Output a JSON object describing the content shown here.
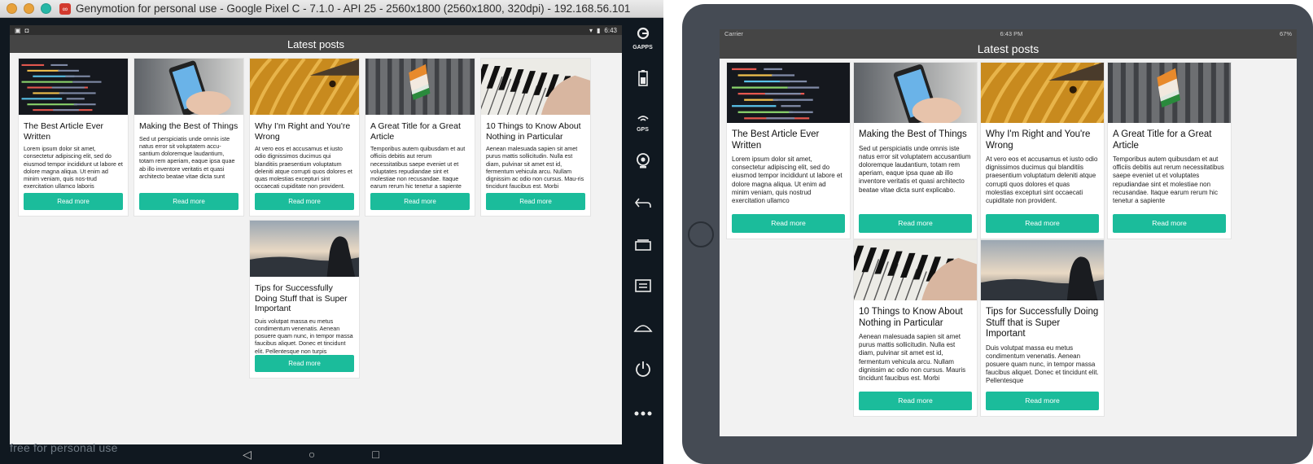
{
  "genymotion": {
    "window_title": "Genymotion for personal use - Google Pixel C - 7.1.0 - API 25 - 2560x1800 (2560x1800, 320dpi) - 192.168.56.101",
    "status_time": "6:43",
    "app_bar_title": "Latest posts",
    "watermark": "free for personal use",
    "sidebar": [
      {
        "name": "gapps-button",
        "label": "GAPPS",
        "icon": "gapps-icon"
      },
      {
        "name": "battery-button",
        "label": "",
        "icon": "battery-icon"
      },
      {
        "name": "gps-button",
        "label": "GPS",
        "icon": "gps-icon"
      },
      {
        "name": "webcam-button",
        "label": "",
        "icon": "webcam-icon"
      },
      {
        "name": "back-button",
        "label": "",
        "icon": "back-icon"
      },
      {
        "name": "recent-apps-button",
        "label": "",
        "icon": "recent-apps-icon"
      },
      {
        "name": "menu-button",
        "label": "",
        "icon": "menu-icon"
      },
      {
        "name": "home-button",
        "label": "",
        "icon": "home-icon"
      },
      {
        "name": "power-button",
        "label": "",
        "icon": "power-icon"
      },
      {
        "name": "more-button",
        "label": "",
        "icon": "more-icon"
      }
    ],
    "nav": {
      "back": "◁",
      "home": "○",
      "recent": "□"
    }
  },
  "ipad": {
    "carrier": "Carrier",
    "time": "6:43 PM",
    "battery": "67%",
    "app_bar_title": "Latest posts"
  },
  "colors": {
    "accent": "#1bbc9b",
    "app_bar": "#454545",
    "background": "#f2f2f2"
  },
  "read_more_label": "Read more",
  "posts": [
    {
      "title": "The Best Article Ever Written",
      "image": "code-screen",
      "excerpt_android": "Lorem ipsum dolor sit amet, consectetur adipiscing elit, sed do eiusmod tempor incididunt ut labore et dolore magna aliqua. Ut enim ad minim veniam, quis nos-trud exercitation ullamco laboris",
      "excerpt_ios": "Lorem ipsum dolor sit amet, consectetur adipiscing elit, sed do eiusmod tempor incididunt ut labore et dolore magna aliqua. Ut enim ad minim veniam, quis nostrud exercitation ullamco"
    },
    {
      "title": "Making the Best of Things",
      "image": "phone-in-hand",
      "excerpt_android": "Sed ut perspiciatis unde omnis iste natus error sit voluptatem accu-santium doloremque laudantium, totam rem aperiam, eaque ipsa quae ab illo inventore veritatis et quasi architecto beatae vitae dicta sunt explicabo. Nemo enim",
      "excerpt_ios": "Sed ut perspiciatis unde omnis iste natus error sit voluptatem accusantium doloremque laudantium, totam rem aperiam, eaque ipsa quae ab illo inventore veritatis et quasi architecto beatae vitae dicta sunt explicabo. Nemo enim ipsam voluptatem"
    },
    {
      "title": "Why I'm Right and You're Wrong",
      "image": "yellow-fabric",
      "excerpt_android": "At vero eos et accusamus et iusto odio dignissimos ducimus qui blanditiis praesentium voluptatum deleniti atque corrupti quos dolores et quas molestias excepturi sint occaecati cupiditate non provident.",
      "excerpt_ios": "At vero eos et accusamus et iusto odio dignissimos ducimus qui blanditiis praesentium voluptatum deleniti atque corrupti quos dolores et quas molestias excepturi sint occaecati cupiditate non provident."
    },
    {
      "title": "A Great Title for a Great Article",
      "image": "building-flag",
      "excerpt_android": "Temporibus autem quibusdam et aut officiis debitis aut rerum necessitatibus saepe eveniet ut et voluptates repudiandae sint et molestiae non recusandae. Itaque earum rerum hic tenetur a sapiente",
      "excerpt_ios": "Temporibus autem quibusdam et aut officiis debitis aut rerum necessitatibus saepe eveniet ut et voluptates repudiandae sint et molestiae non recusandae. Itaque earum rerum hic tenetur a sapiente"
    },
    {
      "title": "10 Things to Know About Nothing in Particular",
      "image": "piano-hand",
      "excerpt_android": "Aenean malesuada sapien sit amet purus mattis sollicitudin. Nulla est diam, pulvinar sit amet est id, fermentum vehicula arcu. Nullam dignissim ac odio non cursus. Mau-ris tincidunt faucibus est. Morbi",
      "excerpt_ios": "Aenean malesuada sapien sit amet purus mattis sollicitudin. Nulla est diam, pulvinar sit amet est id, fermentum vehicula arcu. Nullam dignissim ac odio non cursus. Mauris tincidunt faucibus est. Morbi"
    },
    {
      "title": "Tips for Successfully Doing Stuff that is Super Important",
      "image": "sunset-silhouette",
      "excerpt_android": "Duis volutpat massa eu metus condimentum venenatis. Aenean posuere quam nunc, in tempor massa faucibus aliquet. Donec et tincidunt elit. Pellentesque non turpis",
      "excerpt_ios": "Duis volutpat massa eu metus condimentum venenatis. Aenean posuere quam nunc, in tempor massa faucibus aliquet. Donec et tincidunt elit. Pellentesque"
    }
  ]
}
